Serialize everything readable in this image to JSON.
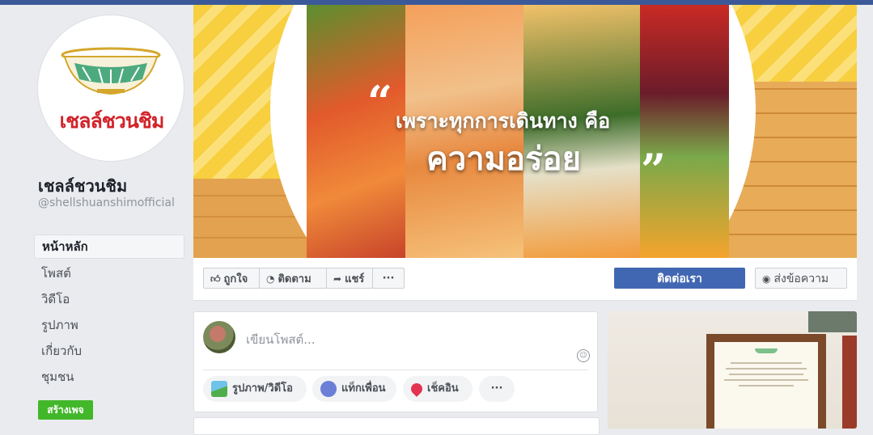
{
  "page": {
    "name": "เชลล์ชวนชิม",
    "handle": "@shellshuanshimofficial",
    "logo_text": "เชลล์ชวนชิม"
  },
  "nav": {
    "items": [
      {
        "label": "หน้าหลัก",
        "active": true
      },
      {
        "label": "โพสต์"
      },
      {
        "label": "วิดีโอ"
      },
      {
        "label": "รูปภาพ"
      },
      {
        "label": "เกี่ยวกับ"
      },
      {
        "label": "ชุมชน"
      }
    ],
    "create_page_label": "สร้างเพจ"
  },
  "cover": {
    "quote_open": "“",
    "line1": "เพราะทุกการเดินทาง คือ",
    "line2": "ความอร่อย",
    "quote_close": "”"
  },
  "actions": {
    "like": "ถูกใจ",
    "follow": "ติดตาม",
    "share": "แชร์",
    "more": "···",
    "contact": "ติดต่อเรา",
    "message": "ส่งข้อความ"
  },
  "composer": {
    "placeholder": "เขียนโพสต์...",
    "photo_video": "รูปภาพ/วิดีโอ",
    "tag_friends": "แท็กเพื่อน",
    "check_in": "เช็คอิน",
    "more": "···"
  },
  "colors": {
    "brand_blue": "#3b5998",
    "contact_button": "#4267b2",
    "create_page_green": "#42b72a",
    "logo_red": "#d2232a"
  }
}
